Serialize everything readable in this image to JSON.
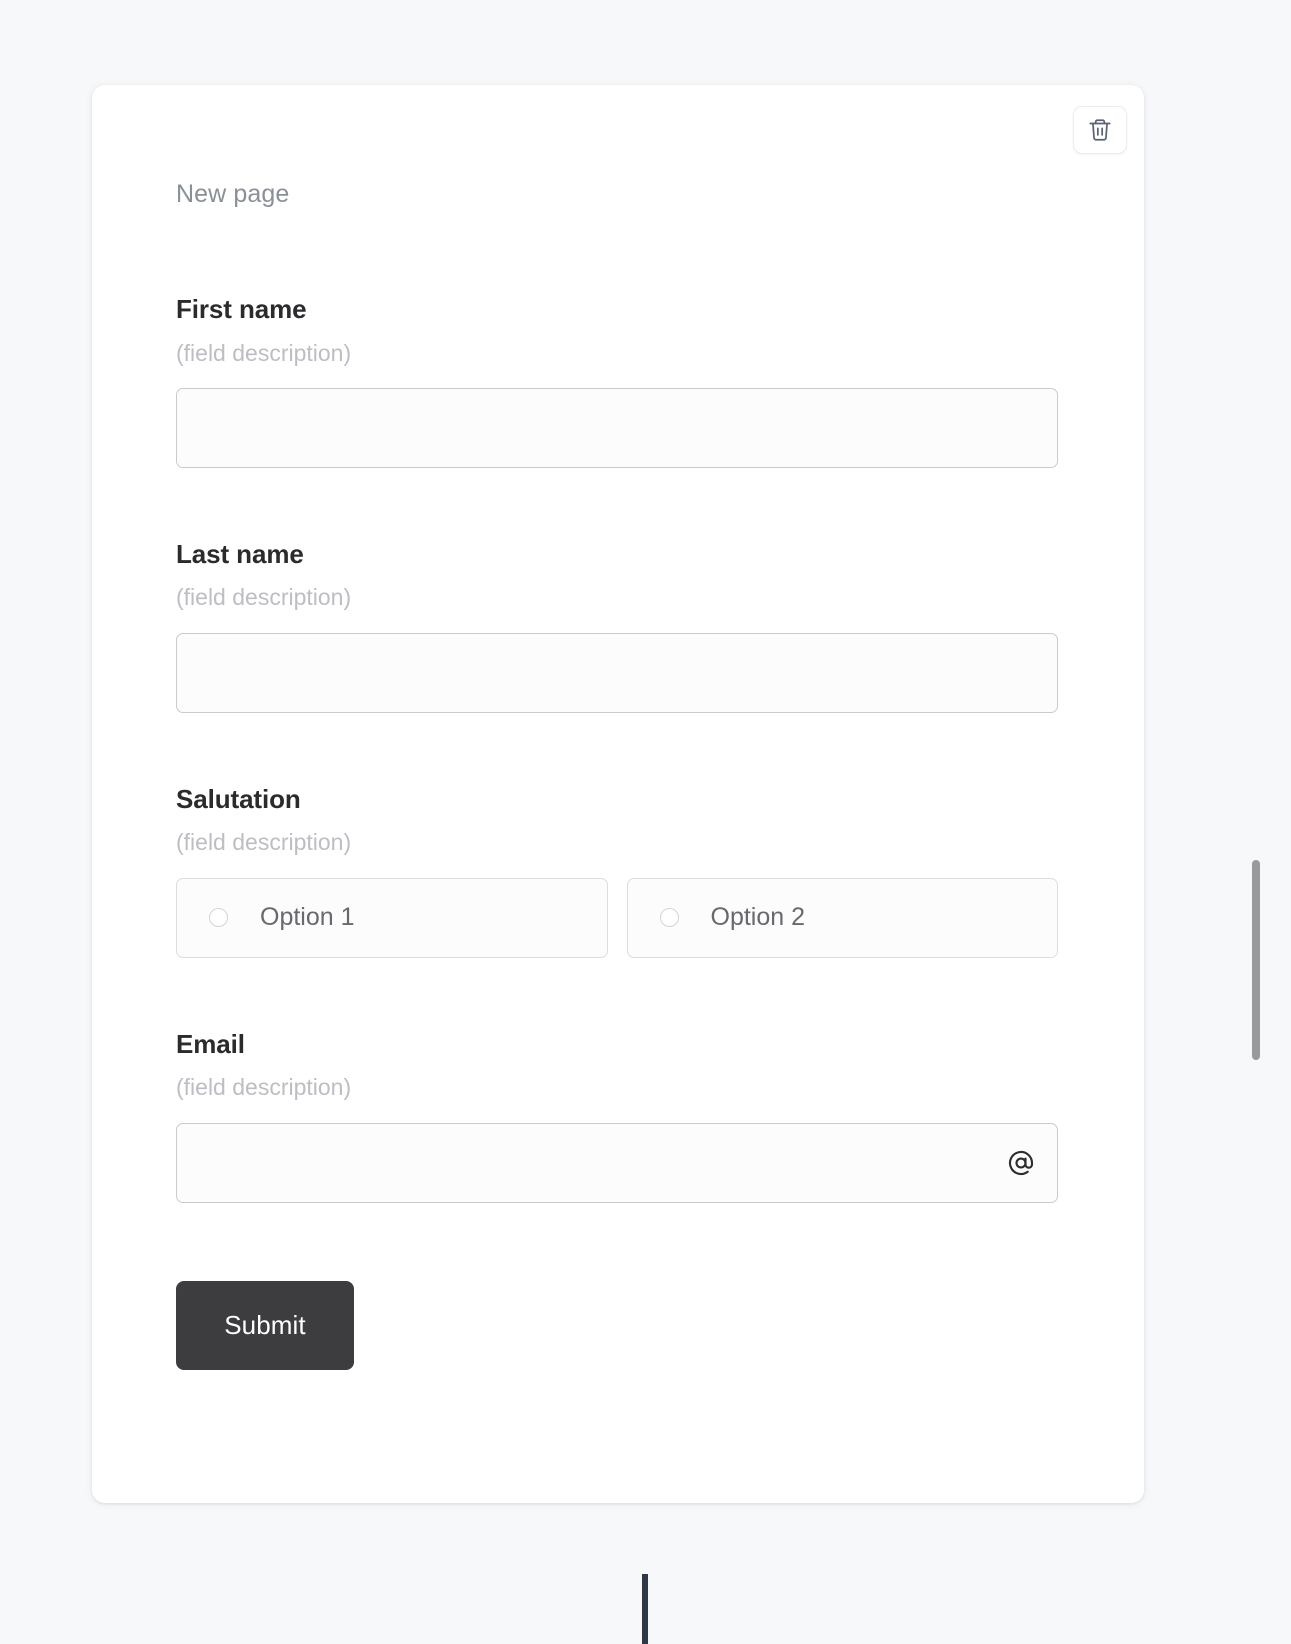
{
  "page": {
    "title": "New page",
    "background_color": "#f7f8fa",
    "card_background": "#ffffff"
  },
  "toolbar": {
    "delete_button_icon": "trash-icon",
    "delete_button_label": ""
  },
  "form": {
    "fields": [
      {
        "label": "First name",
        "description": "(field description)",
        "type": "text",
        "value": "",
        "placeholder": ""
      },
      {
        "label": "Last name",
        "description": "(field description)",
        "type": "text",
        "value": "",
        "placeholder": ""
      },
      {
        "label": "Salutation",
        "description": "(field description)",
        "type": "radio",
        "options": [
          {
            "label": "Option 1",
            "selected": false
          },
          {
            "label": "Option 2",
            "selected": false
          }
        ]
      },
      {
        "label": "Email",
        "description": "(field description)",
        "type": "email",
        "value": "",
        "placeholder": "",
        "adornment_icon": "at-sign-icon"
      }
    ],
    "submit_label": "Submit",
    "submit_color": "#3d3d3f"
  },
  "scrollbar": {
    "thumb_color": "#9a9a9a"
  },
  "divider": {
    "color": "#2f3847"
  }
}
